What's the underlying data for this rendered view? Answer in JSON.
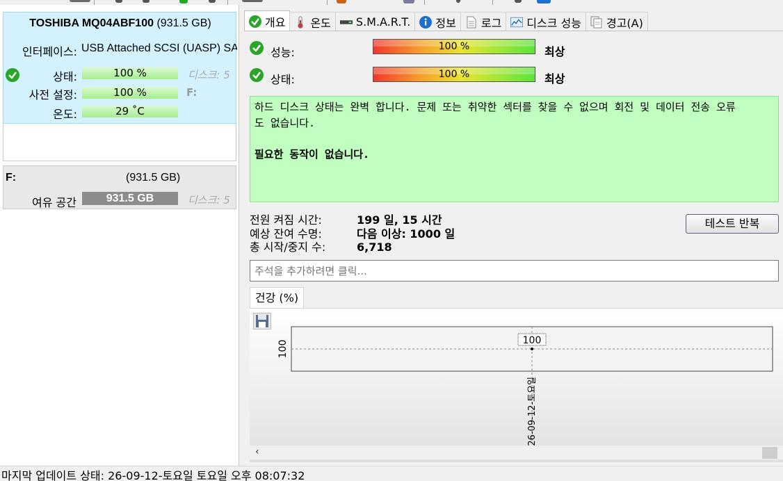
{
  "disk": {
    "model": "TOSHIBA MQ04ABF100",
    "capacity": "(931.5 GB)",
    "interface_label": "인터페이스:",
    "interface_value": "USB Attached SCSI (UASP) SA",
    "status_label": "상태:",
    "status_value": "100 %",
    "preset_label": "사전 설정:",
    "preset_value": "100 %",
    "temp_label": "온도:",
    "temp_value": "29 ˚C",
    "ghost_disk_1": "디스크: 5",
    "ghost_letter": "F:"
  },
  "volume": {
    "letter": "F:",
    "size": "(931.5 GB)",
    "free_label": "여유 공간",
    "free_value": "931.5 GB",
    "ghost_disk": "디스크: 5"
  },
  "tabs": [
    {
      "label": "개요",
      "icon": "check-icon"
    },
    {
      "label": "온도",
      "icon": "thermometer-icon"
    },
    {
      "label": "S.M.A.R.T.",
      "icon": "drive-icon"
    },
    {
      "label": "정보",
      "icon": "info-icon"
    },
    {
      "label": "로그",
      "icon": "document-icon"
    },
    {
      "label": "디스크 성능",
      "icon": "chart-icon"
    },
    {
      "label": "경고(A)",
      "icon": "copy-icon"
    }
  ],
  "overview": {
    "performance_label": "성능:",
    "performance_value": "100 %",
    "performance_rating": "최상",
    "health_label": "상태:",
    "health_value": "100 %",
    "health_rating": "최상",
    "message": "하드 디스크 상태는 완벽 합니다. 문제 또는 취약한 섹터를 찾을 수 없으며 회전 및 데이터 전송 오류도 없습니다.",
    "message_line1": "하드 디스크 상태는 완벽 합니다. 문제 또는 취약한 섹터를 찾을 수 없으며 회전 및 데이터 전송 오류",
    "message_line2": "도 없습니다.",
    "action": "필요한 동작이 없습니다.",
    "power_on_label": "전원 켜짐 시간:",
    "power_on_value": "199 일, 15 시간",
    "lifetime_label": "예상 잔여 수명:",
    "lifetime_value": "다음 이상: 1000 일",
    "start_stop_label": "총 시작/중지 수:",
    "start_stop_value": "6,718",
    "repeat_test_button": "테스트 반복",
    "note_placeholder": "주석을 추가하려면 클릭..."
  },
  "chart_tab": "건강 (%)",
  "chart_data": {
    "type": "line",
    "title": "",
    "x": [
      "26-09-12-토요일"
    ],
    "series": [
      {
        "values": [
          100
        ]
      }
    ],
    "ylabel": "",
    "ytick": "100",
    "point_label": "100",
    "ylim": [
      0,
      200
    ],
    "grid": true
  },
  "statusbar": "마지막 업데이트 상태: 26-09-12-토요일 토요일 오후 08:07:32",
  "colors": {
    "disk_card_bg": "#d4f2fd",
    "message_bg": "#c0ffc0",
    "bar_green": "#a5ee8f",
    "check_green": "#2aa52a"
  }
}
